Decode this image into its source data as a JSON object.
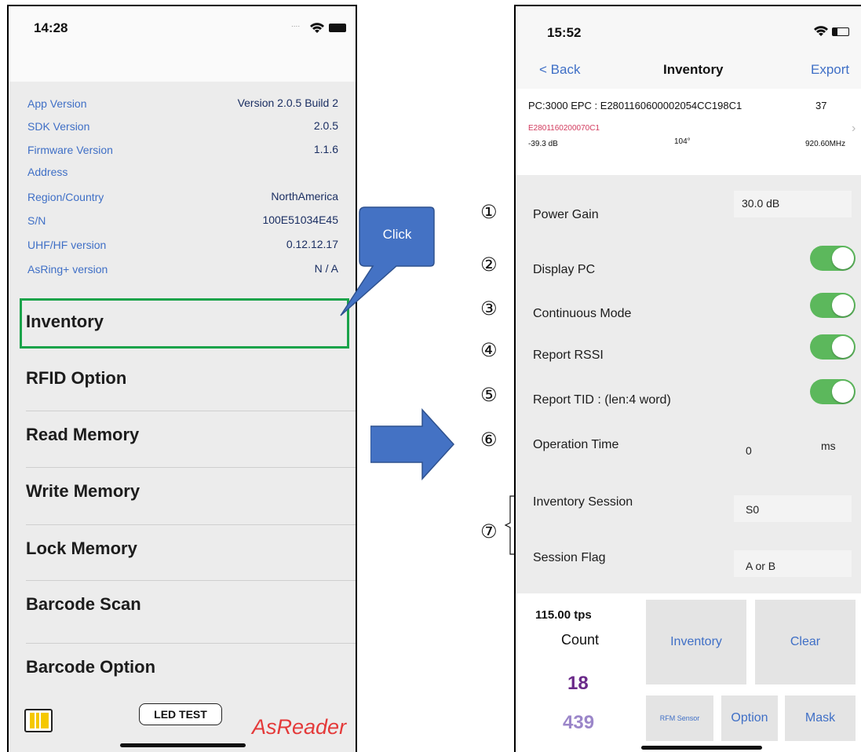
{
  "left": {
    "time": "14:28",
    "status_signal": "....",
    "info": [
      {
        "label": "App Version",
        "value": "Version 2.0.5 Build 2"
      },
      {
        "label": "SDK Version",
        "value": "2.0.5"
      },
      {
        "label": "Firmware Version",
        "value": "1.1.6"
      },
      {
        "label": "Address",
        "value": ""
      },
      {
        "label": "Region/Country",
        "value": "NorthAmerica"
      },
      {
        "label": "S/N",
        "value": "100E51034E45"
      },
      {
        "label": "UHF/HF version",
        "value": "0.12.12.17"
      },
      {
        "label": "AsRing+ version",
        "value": "N / A"
      }
    ],
    "menu": [
      "Inventory",
      "RFID Option",
      "Read Memory",
      "Write Memory",
      "Lock Memory",
      "Barcode Scan",
      "Barcode Option"
    ],
    "led_test": "LED TEST",
    "brand": "AsReader"
  },
  "callout": "Click",
  "right": {
    "time": "15:52",
    "back": "< Back",
    "title": "Inventory",
    "export": "Export",
    "tag": {
      "pc_epc": "PC:3000 EPC : E2801160600002054CC198C1",
      "count": "37",
      "tid": "E2801160200070C1",
      "rssi": "-39.3 dB",
      "phase": "104°",
      "freq": "920.60MHz"
    },
    "settings": {
      "power_gain_label": "Power Gain",
      "power_gain_value": "30.0 dB",
      "display_pc": "Display PC",
      "continuous_mode": "Continuous Mode",
      "report_rssi": "Report RSSI",
      "report_tid": "Report TID : (len:4 word)",
      "operation_time_label": "Operation Time",
      "operation_time_value": "0",
      "operation_time_unit": "ms",
      "inventory_session_label": "Inventory Session",
      "inventory_session_value": "S0",
      "session_flag_label": "Session Flag",
      "session_flag_value": "A or B"
    },
    "toggles": {
      "display_pc": true,
      "continuous_mode": true,
      "report_rssi": true,
      "report_tid": true
    },
    "bottom": {
      "tps": "115.00 tps",
      "count_label": "Count",
      "count_value": "18",
      "total_value": "439",
      "inventory_btn": "Inventory",
      "clear_btn": "Clear",
      "rfm_btn": "RFM Sensor",
      "option_btn": "Option",
      "mask_btn": "Mask"
    }
  },
  "markers": [
    "①",
    "②",
    "③",
    "④",
    "⑤",
    "⑥",
    "⑦"
  ],
  "colors": {
    "accent": "#3f6fc6",
    "toggle_on": "#5cb85c",
    "highlight": "#1aa34a",
    "arrow": "#4472c4",
    "tid": "#d23b5e",
    "count": "#6b2a8a",
    "total": "#9b86c9"
  }
}
